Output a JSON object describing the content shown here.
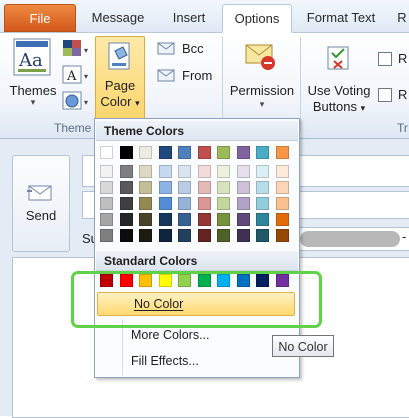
{
  "tabs": [
    "File",
    "Message",
    "Insert",
    "Options",
    "Format Text",
    "R"
  ],
  "active_tab": "Options",
  "ribbon": {
    "themes_label": "Themes",
    "themes_group_label": "Theme",
    "page_color_label_1": "Page",
    "page_color_label_2": "Color",
    "bcc_label": "Bcc",
    "from_label": "From",
    "permission_label": "Permission",
    "voting_label_1": "Use Voting",
    "voting_label_2": "Buttons",
    "request_label": "R",
    "request_label_2": "R",
    "tracking_group_label": "Tr"
  },
  "message": {
    "send_label": "Send",
    "subject_prefix": "Su",
    "to_tail": "-"
  },
  "dropdown": {
    "theme_colors_header": "Theme Colors",
    "standard_colors_header": "Standard Colors",
    "theme_top_row": [
      "#ffffff",
      "#000000",
      "#eeece1",
      "#1f497d",
      "#4f81bd",
      "#c0504d",
      "#9bbb59",
      "#8064a2",
      "#4bacc6",
      "#f79646"
    ],
    "theme_shades": [
      [
        "#f2f2f2",
        "#7f7f7f",
        "#ddd9c3",
        "#c6d9f0",
        "#dbe5f1",
        "#f2dcdb",
        "#ebf1dd",
        "#e5e0ec",
        "#dbeef3",
        "#fdeada"
      ],
      [
        "#d8d8d8",
        "#595959",
        "#c4bd97",
        "#8db3e2",
        "#b8cce4",
        "#e5b9b7",
        "#d7e3bc",
        "#ccc1d9",
        "#b7dde8",
        "#fbd5b5"
      ],
      [
        "#bfbfbf",
        "#3f3f3f",
        "#938953",
        "#548dd4",
        "#95b3d7",
        "#d99694",
        "#c3d69b",
        "#b2a2c7",
        "#92cddc",
        "#fac08f"
      ],
      [
        "#a5a5a5",
        "#262626",
        "#494429",
        "#17365d",
        "#366092",
        "#953734",
        "#76923c",
        "#5f497a",
        "#31859b",
        "#e36c09"
      ],
      [
        "#7f7f7f",
        "#0c0c0c",
        "#1d1b10",
        "#0f243e",
        "#244061",
        "#632423",
        "#4f6128",
        "#3f3151",
        "#205867",
        "#974806"
      ]
    ],
    "standard_colors": [
      "#c00000",
      "#ff0000",
      "#ffc000",
      "#ffff00",
      "#92d050",
      "#00b050",
      "#00b0f0",
      "#0070c0",
      "#002060",
      "#7030a0"
    ],
    "no_color_label": "No Color",
    "more_colors_label": "More Colors...",
    "fill_effects_label": "Fill Effects..."
  },
  "tooltip": "No Color",
  "colors": {
    "file_tab": "#d4581b",
    "highlight_row": "#ffd970",
    "annotation_box": "#5fd24a"
  },
  "icons": [
    "themes-icon",
    "theme-colors-icon",
    "theme-fonts-icon",
    "theme-effects-icon",
    "page-color-icon",
    "bcc-icon",
    "from-icon",
    "permission-icon",
    "voting-icon",
    "send-icon"
  ]
}
